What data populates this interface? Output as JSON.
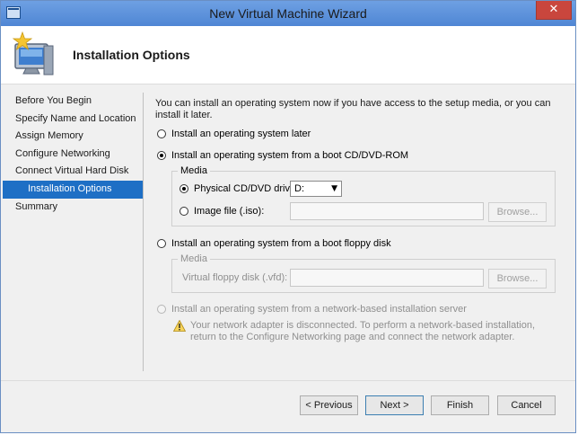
{
  "window": {
    "title": "New Virtual Machine Wizard",
    "close_glyph": "✕"
  },
  "header": {
    "page_title": "Installation Options",
    "icon": "monitor-with-star-icon"
  },
  "nav": {
    "items": [
      {
        "label": "Before You Begin"
      },
      {
        "label": "Specify Name and Location"
      },
      {
        "label": "Assign Memory"
      },
      {
        "label": "Configure Networking"
      },
      {
        "label": "Connect Virtual Hard Disk"
      },
      {
        "label": "Installation Options",
        "selected": true
      },
      {
        "label": "Summary"
      }
    ]
  },
  "content": {
    "intro": "You can install an operating system now if you have access to the setup media, or you can install it later.",
    "options": {
      "later": "Install an operating system later",
      "cd": "Install an operating system from a boot CD/DVD-ROM",
      "floppy": "Install an operating system from a boot floppy disk",
      "network": "Install an operating system from a network-based installation server"
    },
    "cd_media": {
      "group_label": "Media",
      "physical_label": "Physical CD/DVD drive:",
      "drive_value": "D:",
      "image_label": "Image file (.iso):",
      "image_value": "",
      "browse_label": "Browse..."
    },
    "floppy_media": {
      "group_label": "Media",
      "vfd_label": "Virtual floppy disk (.vfd):",
      "vfd_value": "",
      "browse_label": "Browse..."
    },
    "network_warning": "Your network adapter is disconnected. To perform a network-based installation, return to the Configure Networking page and connect the network adapter."
  },
  "buttons": {
    "previous": "< Previous",
    "next": "Next >",
    "finish": "Finish",
    "cancel": "Cancel"
  },
  "colors": {
    "accent": "#1e6fc5",
    "titlebar": "#5b8fd7",
    "close": "#c9463d"
  }
}
